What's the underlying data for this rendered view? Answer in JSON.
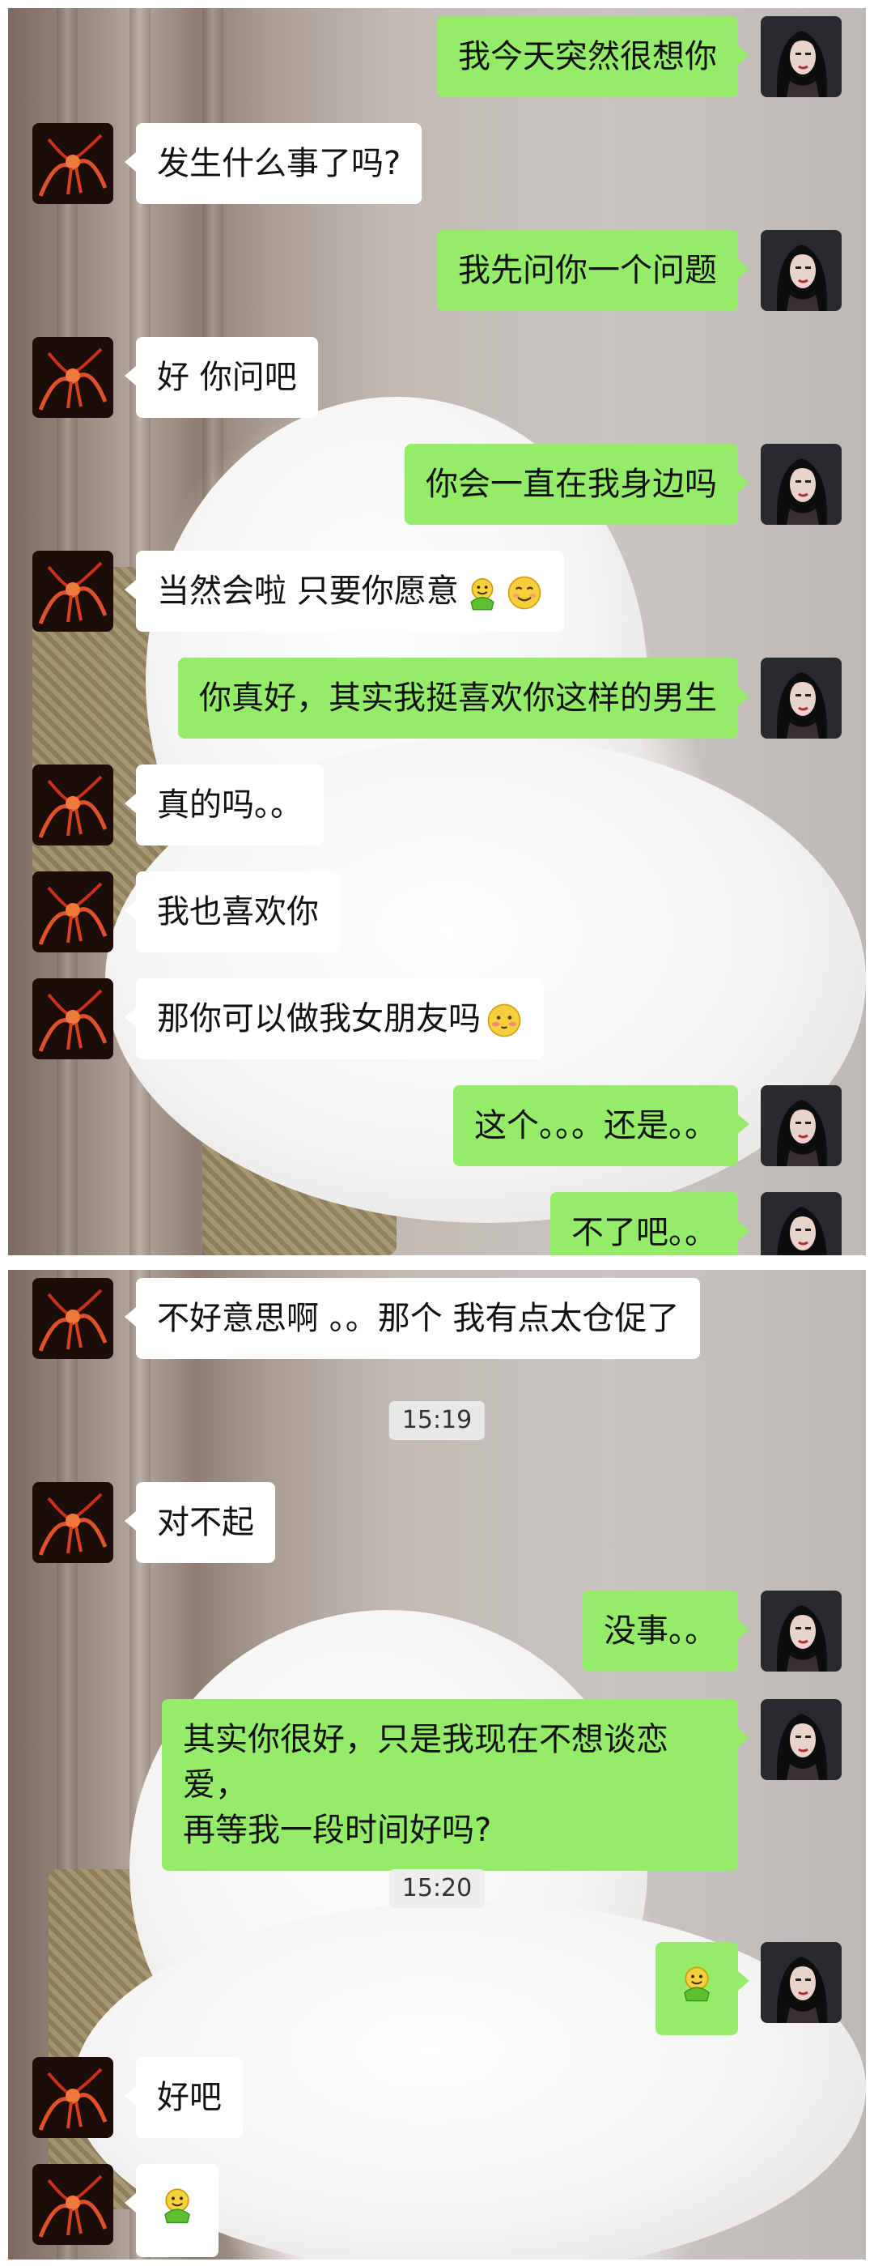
{
  "screenshot_top": {
    "messages": [
      {
        "side": "right",
        "text": "我今天突然很想你"
      },
      {
        "side": "left",
        "text": "发生什么事了吗?"
      },
      {
        "side": "right",
        "text": "我先问你一个问题"
      },
      {
        "side": "left",
        "text": "好 你问吧"
      },
      {
        "side": "right",
        "text": "你会一直在我身边吗"
      },
      {
        "side": "left",
        "text": "当然会啦 只要你愿意"
      },
      {
        "side": "right",
        "text": "你真好，其实我挺喜欢你这样的男生"
      },
      {
        "side": "left",
        "text": "真的吗。。"
      },
      {
        "side": "left",
        "text": "我也喜欢你"
      },
      {
        "side": "left",
        "text": "那你可以做我女朋友吗"
      },
      {
        "side": "right",
        "text": "这个。。。还是。。"
      },
      {
        "side": "right",
        "text": "不了吧。。"
      }
    ]
  },
  "screenshot_bottom": {
    "messages": [
      {
        "side": "left",
        "text": "不好意思啊 。。那个 我有点太仓促了"
      },
      {
        "side": "left",
        "text": "对不起"
      },
      {
        "side": "right",
        "text": "没事。。"
      },
      {
        "side": "right",
        "line1": "其实你很好，只是我现在不想谈恋爱，",
        "line2": "再等我一段时间好吗?"
      },
      {
        "side": "left",
        "text": "好吧"
      }
    ],
    "timestamps": [
      "15:19",
      "15:20"
    ]
  },
  "icons": {
    "hug_emoji": "hug-emoji",
    "smile_emoji": "smiling-face-emoji",
    "blush_emoji": "blushing-face-emoji"
  },
  "colors": {
    "outgoing_bubble": "#95ec69",
    "incoming_bubble": "#ffffff",
    "timestamp_bg": "#ebebeb"
  }
}
